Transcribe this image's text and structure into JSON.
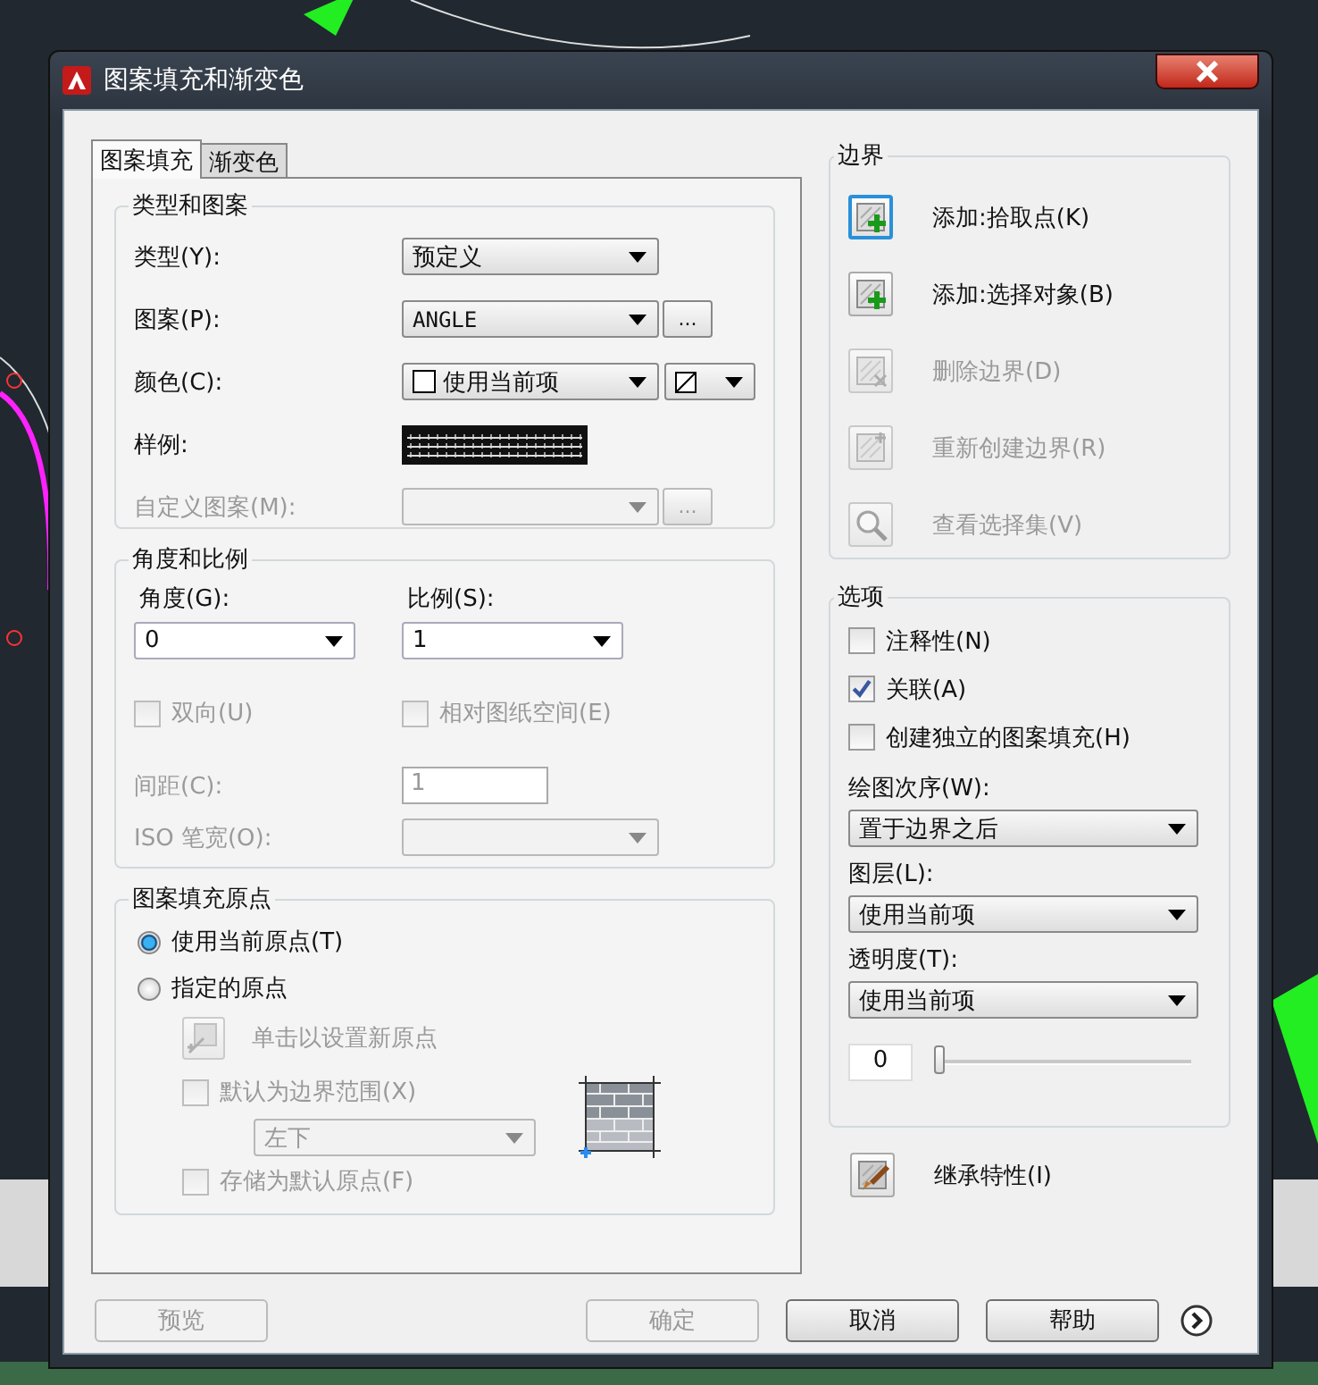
{
  "window": {
    "title": "图案填充和渐变色"
  },
  "tabs": [
    {
      "label": "图案填充",
      "selected": true
    },
    {
      "label": "渐变色",
      "selected": false
    }
  ],
  "type_and_pattern": {
    "title": "类型和图案",
    "fields": [
      {
        "kind": "dropdown",
        "label": "类型(Y):",
        "value": "预定义",
        "disabled": false
      },
      {
        "kind": "dropdown_browse",
        "label": "图案(P):",
        "value": "ANGLE",
        "browse": "...",
        "disabled": false
      },
      {
        "kind": "color",
        "label": "颜色(C):",
        "value": "使用当前项",
        "disabled": false
      },
      {
        "kind": "swatch",
        "label": "样例:",
        "disabled": false
      },
      {
        "kind": "dropdown_browse",
        "label": "自定义图案(M):",
        "browse": "...",
        "disabled": true
      }
    ]
  },
  "angle_and_scale": {
    "title": "角度和比例",
    "angle": {
      "label": "角度(G):",
      "value": "0"
    },
    "scale": {
      "label": "比例(S):",
      "value": "1"
    },
    "checks": [
      {
        "label": "双向(U)",
        "checked": false,
        "disabled": true
      },
      {
        "label": "相对图纸空间(E)",
        "checked": false,
        "disabled": true
      }
    ],
    "spacing": {
      "label": "间距(C):",
      "value": "1",
      "disabled": true
    },
    "iso_pen_width": {
      "label": "ISO 笔宽(O):",
      "disabled": true
    }
  },
  "origin": {
    "title": "图案填充原点",
    "radios": [
      {
        "label": "使用当前原点(T)",
        "selected": true
      },
      {
        "label": "指定的原点",
        "selected": false
      }
    ],
    "click_to_set": {
      "label": "单击以设置新原点",
      "disabled": true
    },
    "default_extent": {
      "label": "默认为边界范围(X)",
      "checked": false,
      "disabled": true
    },
    "position": {
      "value": "左下",
      "disabled": true
    },
    "store_default": {
      "label": "存储为默认原点(F)",
      "checked": false,
      "disabled": true
    }
  },
  "boundaries": {
    "title": "边界",
    "items": [
      {
        "kind": "pick",
        "label": "添加:拾取点(K)",
        "disabled": false,
        "highlighted": true
      },
      {
        "kind": "select",
        "label": "添加:选择对象(B)",
        "disabled": false,
        "highlighted": false
      },
      {
        "kind": "remove",
        "label": "删除边界(D)",
        "disabled": true,
        "highlighted": false
      },
      {
        "kind": "recreate",
        "label": "重新创建边界(R)",
        "disabled": true,
        "highlighted": false
      },
      {
        "kind": "view",
        "label": "查看选择集(V)",
        "disabled": true,
        "highlighted": false
      }
    ]
  },
  "options": {
    "title": "选项",
    "checks": [
      {
        "label": "注释性(N)",
        "checked": false
      },
      {
        "label": "关联(A)",
        "checked": true
      },
      {
        "label": "创建独立的图案填充(H)",
        "checked": false
      }
    ],
    "dropdowns": [
      {
        "label": "绘图次序(W):",
        "value": "置于边界之后"
      },
      {
        "label": "图层(L):",
        "value": "使用当前项"
      },
      {
        "label": "透明度(T):",
        "value": "使用当前项"
      }
    ],
    "transparency": {
      "value": "0",
      "level": 0
    }
  },
  "inherit": {
    "label": "继承特性(I)"
  },
  "buttons": [
    {
      "label": "预览",
      "disabled": true
    },
    {
      "label": "确定",
      "disabled": true
    },
    {
      "label": "取消",
      "disabled": false
    },
    {
      "label": "帮助",
      "disabled": false
    }
  ]
}
